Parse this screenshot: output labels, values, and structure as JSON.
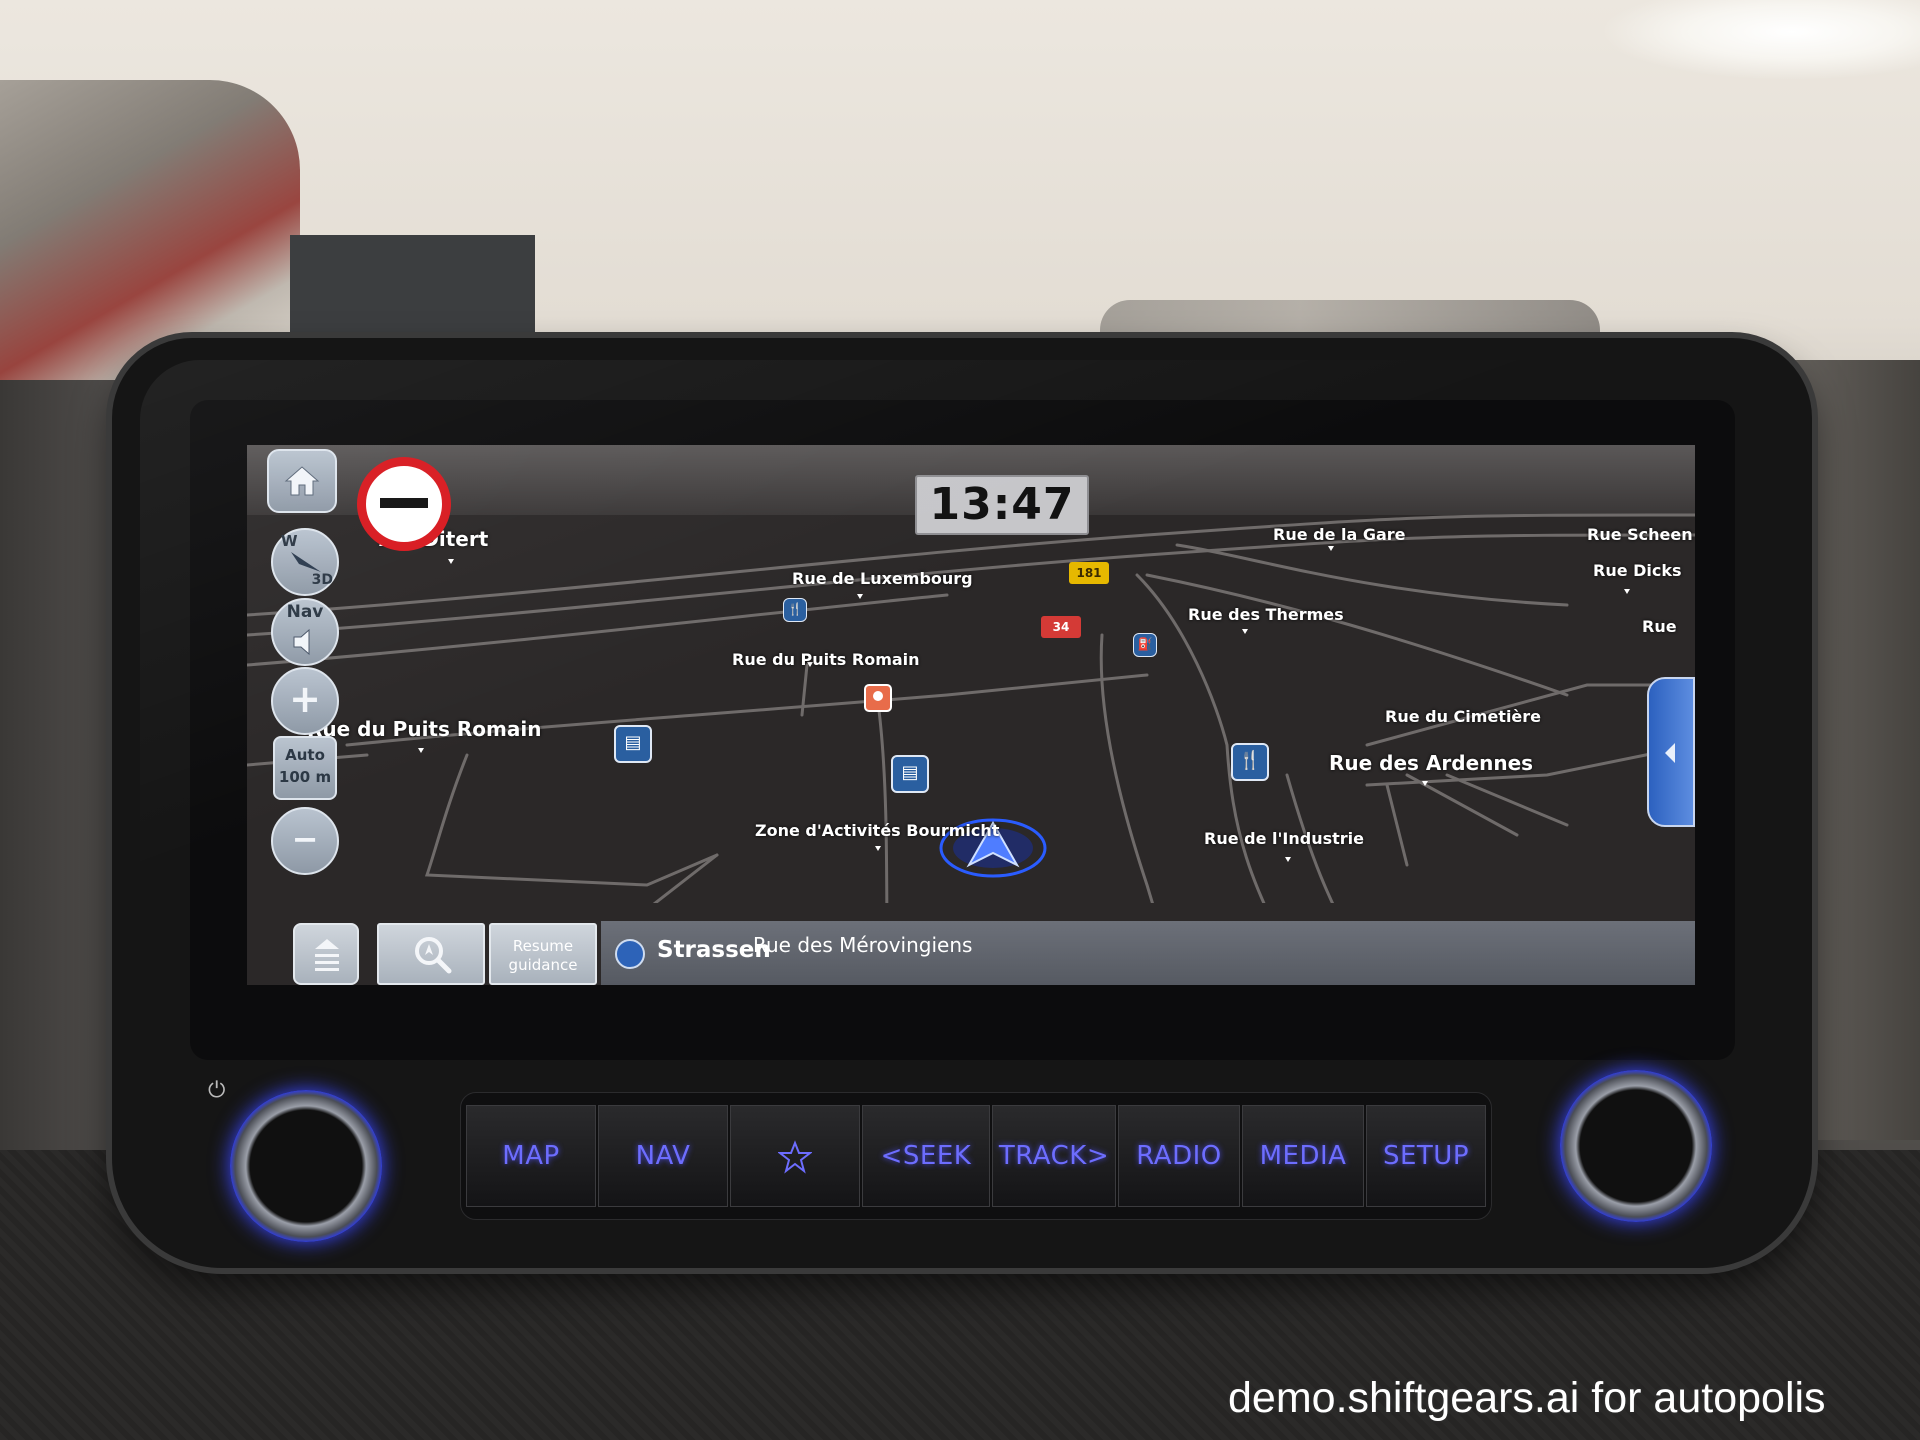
{
  "status_bar": {
    "clock": "13:47"
  },
  "map_controls": {
    "home_icon": "home-icon",
    "compass_direction": "W",
    "view_mode": "3D",
    "nav_volume_label": "Nav",
    "zoom_in_label": "+",
    "zoom_scale_mode": "Auto",
    "zoom_scale_value": "100 m",
    "zoom_out_label": "−"
  },
  "map": {
    "road_labels": [
      "Am Ditert",
      "Rue de Luxembourg",
      "Rue de la Gare",
      "Rue Scheen",
      "Rue Dicks",
      "Rue des Thermes",
      "Rue",
      "Rue du Puits Romain",
      "Rue du Puits Romain",
      "Rue du Cimetière",
      "Rue des Ardennes",
      "Zone d'Activités Bourmicht",
      "Rue de l'Industrie"
    ],
    "route_shields": [
      "181",
      "34"
    ],
    "colors": {
      "background": "#2b2828",
      "road": "#6f6b6a",
      "route_red": "#d43a36",
      "route_yellow": "#e6b800",
      "poi_blue": "#2a5fa0",
      "car_marker": "#1f4fe0"
    }
  },
  "bottom_bar": {
    "menu_icon": "menu-icon",
    "search_icon": "search-icon",
    "resume_line1": "Resume",
    "resume_line2": "guidance",
    "current_street": "Strassen",
    "next_street": "Rue des Mérovingiens"
  },
  "hardware_buttons": {
    "map": "MAP",
    "nav": "NAV",
    "favorite_icon": "star-icon",
    "seek": "<SEEK",
    "track": "TRACK>",
    "radio": "RADIO",
    "media": "MEDIA",
    "setup": "SETUP"
  },
  "watermark": "demo.shiftgears.ai for autopolis"
}
